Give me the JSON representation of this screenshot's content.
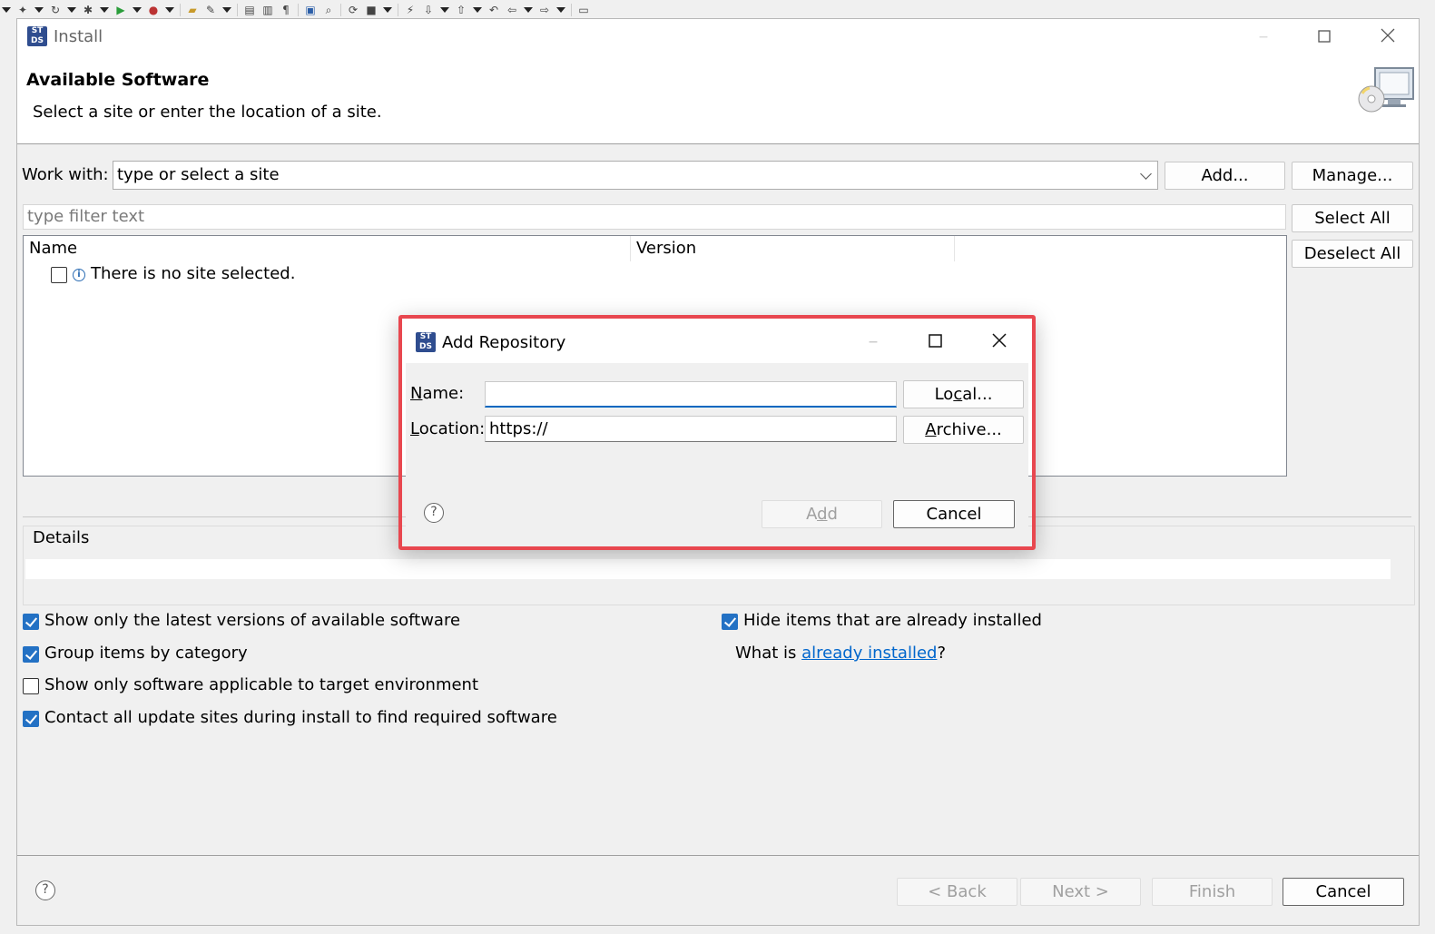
{
  "install_window": {
    "title": "Install",
    "header": {
      "title": "Available Software",
      "description": "Select a site or enter the location of a site."
    },
    "work_with": {
      "label": "Work with:",
      "value": "type or select a site",
      "add_button": "Add...",
      "manage_button": "Manage..."
    },
    "filter_placeholder": "type filter text",
    "select_all": "Select All",
    "deselect_all": "Deselect All",
    "tree": {
      "columns": [
        "Name",
        "Version"
      ],
      "rows": [
        {
          "label": "There is no site selected.",
          "checked": false
        }
      ]
    },
    "details_label": "Details",
    "options": [
      {
        "label": "Show only the latest versions of available software",
        "checked": true
      },
      {
        "label": "Group items by category",
        "checked": true
      },
      {
        "label": "Show only software applicable to target environment",
        "checked": false
      },
      {
        "label": "Contact all update sites during install to find required software",
        "checked": true
      }
    ],
    "hide_installed": {
      "label": "Hide items that are already installed",
      "checked": true
    },
    "what_is": {
      "prefix": "What is ",
      "link": "already installed",
      "suffix": "?"
    },
    "footer": {
      "back": "< Back",
      "next": "Next >",
      "finish": "Finish",
      "cancel": "Cancel"
    }
  },
  "add_repository_dialog": {
    "title": "Add Repository",
    "name_label": {
      "mnemonic": "N",
      "rest": "ame:"
    },
    "name_value": "",
    "location_label": {
      "mnemonic": "L",
      "rest": "ocation:"
    },
    "location_value": "https://",
    "local_button": {
      "pre": "Lo",
      "mnemonic": "c",
      "post": "al..."
    },
    "archive_button": {
      "pre": "",
      "mnemonic": "A",
      "post": "rchive..."
    },
    "add_button": {
      "pre": "A",
      "mnemonic": "d",
      "post": "d"
    },
    "cancel_button": "Cancel"
  },
  "colors": {
    "highlight_border": "#e8474f",
    "checkbox_checked": "#2371c4",
    "link": "#0066cc",
    "focus_underline": "#0067c0"
  },
  "icons": [
    "app-logo-icon",
    "maximize-icon",
    "close-icon",
    "dropdown-arrow-icon",
    "info-icon",
    "help-icon",
    "install-software-banner-icon"
  ]
}
